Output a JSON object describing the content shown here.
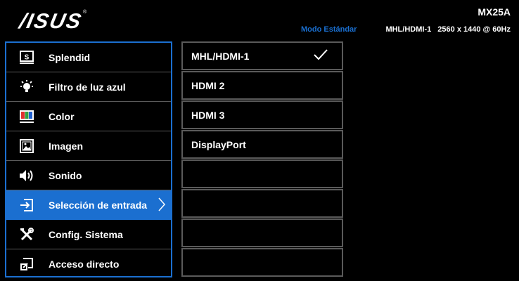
{
  "header": {
    "brand": "/ISUS",
    "registered_mark": "®",
    "model": "MX25A",
    "mode": "Modo Estándar",
    "signal": {
      "input": "MHL/HDMI-1",
      "resolution": "2560 x 1440 @ 60Hz"
    }
  },
  "main_menu": {
    "accent_color": "#1b6fd0",
    "items": [
      {
        "label": "Splendid",
        "icon": "splendid-icon"
      },
      {
        "label": "Filtro de luz azul",
        "icon": "blue-light-filter-icon"
      },
      {
        "label": "Color",
        "icon": "color-icon"
      },
      {
        "label": "Imagen",
        "icon": "image-icon"
      },
      {
        "label": "Sonido",
        "icon": "speaker-icon"
      },
      {
        "label": "Selección de entrada",
        "icon": "input-select-icon",
        "selected": true
      },
      {
        "label": "Config. Sistema",
        "icon": "system-setup-icon"
      },
      {
        "label": "Acceso directo",
        "icon": "shortcut-icon"
      }
    ]
  },
  "sub_menu": {
    "items": [
      {
        "label": "MHL/HDMI-1",
        "checked": true
      },
      {
        "label": "HDMI 2"
      },
      {
        "label": "HDMI 3"
      },
      {
        "label": "DisplayPort"
      },
      {
        "label": ""
      },
      {
        "label": ""
      },
      {
        "label": ""
      },
      {
        "label": ""
      }
    ]
  }
}
